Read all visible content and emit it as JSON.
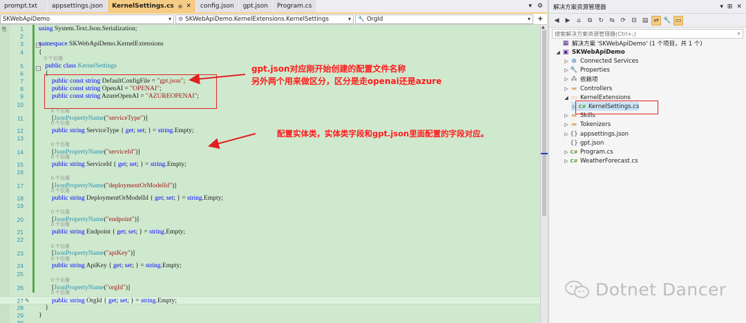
{
  "tabs": [
    {
      "label": "prompt.txt",
      "active": false
    },
    {
      "label": "appsettings.json",
      "active": false
    },
    {
      "label": "KernelSettings.cs",
      "active": true
    },
    {
      "label": "config.json",
      "active": false
    },
    {
      "label": "gpt.json",
      "active": false
    },
    {
      "label": "Program.cs",
      "active": false
    }
  ],
  "tab_controls": {
    "dropdown": "▾",
    "settings": "⚙"
  },
  "navbar": {
    "project": "SKWebApiDemo",
    "class": "SKWebApiDemo.KernelExtensions.KernelSettings",
    "member": "OrgId"
  },
  "code_lines": [
    {
      "n": "1",
      "html": "<span class=\"kw\">using</span> System.Text.Json.Serialization;"
    },
    {
      "n": "2",
      "html": ""
    },
    {
      "n": "3",
      "html": "<span class=\"kw\">namespace</span> SKWebApiDemo.KernelExtensions"
    },
    {
      "n": "4",
      "html": "{"
    },
    {
      "n": "5",
      "html": "    <span class=\"kw\">public class</span> <span class=\"typ\">KernelSettings</span>"
    },
    {
      "n": "6",
      "html": "    {"
    },
    {
      "n": "7",
      "html": "        <span class=\"kw\">public const string</span> DefaultConfigFile = <span class=\"str\">\"gpt.json\"</span>;"
    },
    {
      "n": "8",
      "html": "        <span class=\"kw\">public const string</span> OpenAI = <span class=\"str\">\"OPENAI\"</span>;"
    },
    {
      "n": "9",
      "html": "        <span class=\"kw\">public const string</span> AzureOpenAI = <span class=\"str\">\"AZUREOPENAI\"</span>;"
    },
    {
      "n": "10",
      "html": ""
    },
    {
      "n": "11",
      "html": "        [<span class=\"typ\">JsonPropertyName</span>(<span class=\"str\">\"serviceType\"</span>)]"
    },
    {
      "n": "12",
      "html": "        <span class=\"kw\">public string</span> ServiceType { <span class=\"kw\">get</span>; <span class=\"kw\">set</span>; } = <span class=\"kw\">string</span>.Empty;"
    },
    {
      "n": "13",
      "html": ""
    },
    {
      "n": "14",
      "html": "        [<span class=\"typ\">JsonPropertyName</span>(<span class=\"str\">\"serviceId\"</span>)]"
    },
    {
      "n": "15",
      "html": "        <span class=\"kw\">public string</span> ServiceId { <span class=\"kw\">get</span>; <span class=\"kw\">set</span>; } = <span class=\"kw\">string</span>.Empty;"
    },
    {
      "n": "16",
      "html": ""
    },
    {
      "n": "17",
      "html": "        [<span class=\"typ\">JsonPropertyName</span>(<span class=\"str\">\"deploymentOrModelId\"</span>)]"
    },
    {
      "n": "18",
      "html": "        <span class=\"kw\">public string</span> DeploymentOrModelId { <span class=\"kw\">get</span>; <span class=\"kw\">set</span>; } = <span class=\"kw\">string</span>.Empty;"
    },
    {
      "n": "19",
      "html": ""
    },
    {
      "n": "20",
      "html": "        [<span class=\"typ\">JsonPropertyName</span>(<span class=\"str\">\"endpoint\"</span>)]"
    },
    {
      "n": "21",
      "html": "        <span class=\"kw\">public string</span> Endpoint { <span class=\"kw\">get</span>; <span class=\"kw\">set</span>; } = <span class=\"kw\">string</span>.Empty;"
    },
    {
      "n": "22",
      "html": ""
    },
    {
      "n": "23",
      "html": "        [<span class=\"typ\">JsonPropertyName</span>(<span class=\"str\">\"apiKey\"</span>)]"
    },
    {
      "n": "24",
      "html": "        <span class=\"kw\">public string</span> ApiKey { <span class=\"kw\">get</span>; <span class=\"kw\">set</span>; } = <span class=\"kw\">string</span>.Empty;"
    },
    {
      "n": "25",
      "html": ""
    },
    {
      "n": "26",
      "html": "        [<span class=\"typ\">JsonPropertyName</span>(<span class=\"str\">\"orgId\"</span>)]"
    },
    {
      "n": "27",
      "html": "        <span class=\"kw\">public string</span> OrgId { <span class=\"kw\">get</span>; <span class=\"kw\">set</span>; } = <span class=\"kw\">string</span>.Empty;"
    },
    {
      "n": "28",
      "html": "    }"
    },
    {
      "n": "29",
      "html": "}"
    },
    {
      "n": "30",
      "html": ""
    }
  ],
  "ref_label": "0 个引用",
  "annotations": {
    "note1_line1": "gpt.json对应刚开始创建的配置文件名称",
    "note1_line2": "另外两个用来做区分，区分是走openai还是azure",
    "note2": "配置实体类，实体类字段和gpt.json里面配置的字段对应。"
  },
  "solution_explorer": {
    "title": "解决方案资源管理器",
    "search_placeholder": "搜索解决方案资源管理器(Ctrl+;)",
    "items": [
      {
        "label": "解决方案 'SKWebApiDemo' (1 个项目，共 1 个)",
        "icon": "solution-icon",
        "depth": 0,
        "expander": ""
      },
      {
        "label": "SKWebApiDemo",
        "icon": "project-icon",
        "depth": 0,
        "expander": "open",
        "bold": true
      },
      {
        "label": "Connected Services",
        "icon": "connected-services-icon",
        "depth": 1,
        "expander": "closed"
      },
      {
        "label": "Properties",
        "icon": "properties-icon",
        "depth": 1,
        "expander": "closed"
      },
      {
        "label": "依赖项",
        "icon": "dependencies-icon",
        "depth": 1,
        "expander": "closed"
      },
      {
        "label": "Controllers",
        "icon": "folder-icon",
        "depth": 1,
        "expander": "closed"
      },
      {
        "label": "KernelExtensions",
        "icon": "folder-open-icon",
        "depth": 1,
        "expander": "open"
      },
      {
        "label": "KernelSettings.cs",
        "icon": "csharp-file-icon",
        "depth": 2,
        "expander": "closed",
        "selected": true
      },
      {
        "label": "Skills",
        "icon": "folder-icon",
        "depth": 1,
        "expander": "closed"
      },
      {
        "label": "Tokenizers",
        "icon": "folder-icon",
        "depth": 1,
        "expander": "closed"
      },
      {
        "label": "appsettings.json",
        "icon": "json-file-icon",
        "depth": 1,
        "expander": "closed"
      },
      {
        "label": "gpt.json",
        "icon": "json-file-icon",
        "depth": 1,
        "expander": ""
      },
      {
        "label": "Program.cs",
        "icon": "csharp-file-icon",
        "depth": 1,
        "expander": "closed"
      },
      {
        "label": "WeatherForecast.cs",
        "icon": "csharp-file-icon",
        "depth": 1,
        "expander": "closed"
      }
    ]
  },
  "watermark": {
    "text": "Dotnet Dancer",
    "icon": "wechat-icon"
  },
  "colors": {
    "editor_bg": "#cfe9cf",
    "accent_tab": "#f5cc84",
    "annotation_red": "#ff1a1a",
    "keyword": "#0000ff",
    "type": "#2b91af",
    "string": "#a31515"
  }
}
